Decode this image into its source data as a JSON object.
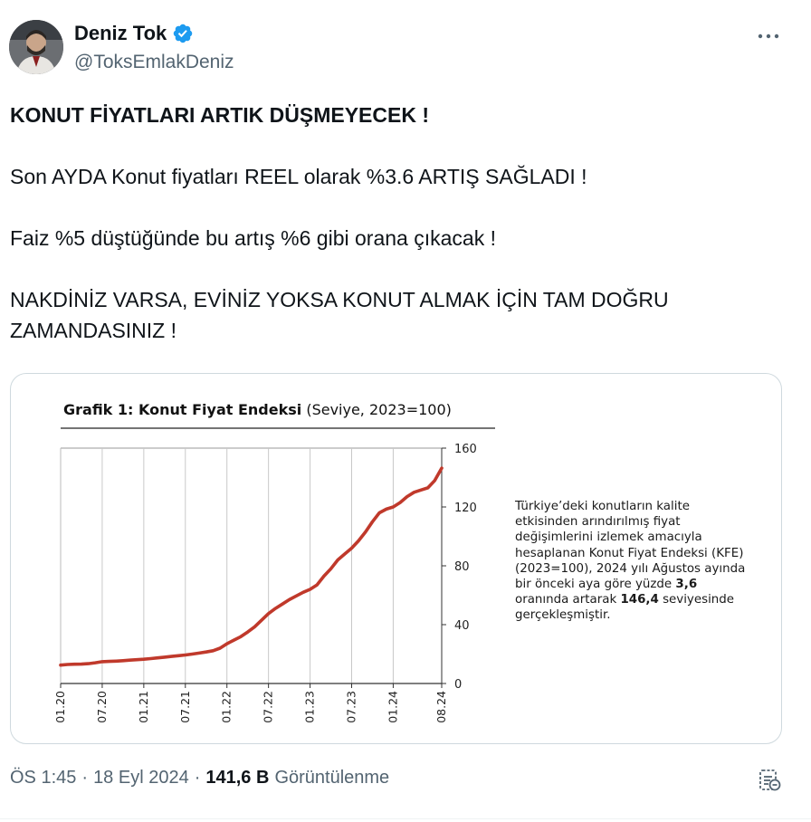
{
  "author": {
    "display_name": "Deniz Tok",
    "handle": "@ToksEmlakDeniz",
    "verified": true,
    "verified_color": "#1d9bf0"
  },
  "tweet": {
    "headline": "KONUT FİYATLARI ARTIK DÜŞMEYECEK !",
    "para1": "Son AYDA Konut fiyatları REEL olarak %3.6 ARTIŞ SAĞLADI !",
    "para2": "Faiz %5 düştüğünde bu artış %6 gibi orana çıkacak !",
    "para3": "NAKDİNİZ VARSA, EVİNİZ YOKSA KONUT ALMAK İÇİN TAM DOĞRU ZAMANDASINIZ !"
  },
  "media": {
    "chart_title_bold": "Grafik 1: Konut Fiyat Endeksi",
    "chart_title_rest": "(Seviye, 2023=100)",
    "side_text_1": "Türkiye’deki konutların kalite etkisinden arındırılmış fiyat değişimlerini izlemek amacıyla hesaplanan Konut Fiyat Endeksi (KFE) (2023=100), 2024 yılı Ağustos ayında bir önceki aya göre yüzde ",
    "side_text_bold_1": "3,6",
    "side_text_2": " oranında artarak ",
    "side_text_bold_2": "146,4",
    "side_text_3": " seviyesinde gerçekleşmiştir."
  },
  "chart_data": {
    "type": "line",
    "title": "Grafik 1: Konut Fiyat Endeksi (Seviye, 2023=100)",
    "xlabel": "",
    "ylabel": "",
    "ylim": [
      0,
      160
    ],
    "yticks": [
      0,
      40,
      80,
      120,
      160
    ],
    "xticks": [
      "01.20",
      "07.20",
      "01.21",
      "07.21",
      "01.22",
      "07.22",
      "01.23",
      "07.23",
      "01.24",
      "08.24"
    ],
    "grid": "vertical",
    "line_color": "#c0392b",
    "series": [
      {
        "x": [
          0,
          1,
          2,
          3,
          4,
          5,
          6,
          7,
          8,
          9,
          10,
          11,
          12,
          13,
          14,
          15,
          16,
          17,
          18,
          19,
          20,
          21,
          22,
          23,
          24,
          25,
          26,
          27,
          28,
          29,
          30,
          31,
          32,
          33,
          34,
          35,
          36,
          37,
          38,
          39,
          40,
          41,
          42,
          43,
          44,
          45,
          46,
          47,
          48,
          49,
          50,
          51,
          52,
          53,
          54,
          55
        ],
        "values": [
          12.5,
          12.9,
          13.1,
          13.2,
          13.5,
          14.1,
          14.8,
          15.0,
          15.2,
          15.5,
          15.9,
          16.2,
          16.5,
          16.9,
          17.4,
          17.9,
          18.4,
          18.9,
          19.4,
          20.0,
          20.7,
          21.4,
          22.3,
          24.0,
          27.0,
          29.5,
          31.8,
          35.0,
          38.5,
          43.0,
          47.5,
          51.0,
          54.0,
          57.0,
          59.5,
          62.0,
          64.0,
          67.0,
          73.0,
          78.0,
          84.0,
          88.0,
          92.0,
          97.0,
          103.0,
          110.0,
          116.0,
          118.5,
          120.0,
          123.0,
          127.0,
          130.0,
          131.5,
          133.0,
          138.0,
          146.4
        ]
      }
    ]
  },
  "footer": {
    "time": "ÖS 1:45",
    "sep": "·",
    "date": "18 Eyl 2024",
    "sep2": "·",
    "views": "141,6 B",
    "views_label": "Görüntülenme"
  },
  "icons": {
    "more": "more-horizontal-icon",
    "engagement": "view-engagements-icon",
    "verified": "verified-badge-icon"
  }
}
